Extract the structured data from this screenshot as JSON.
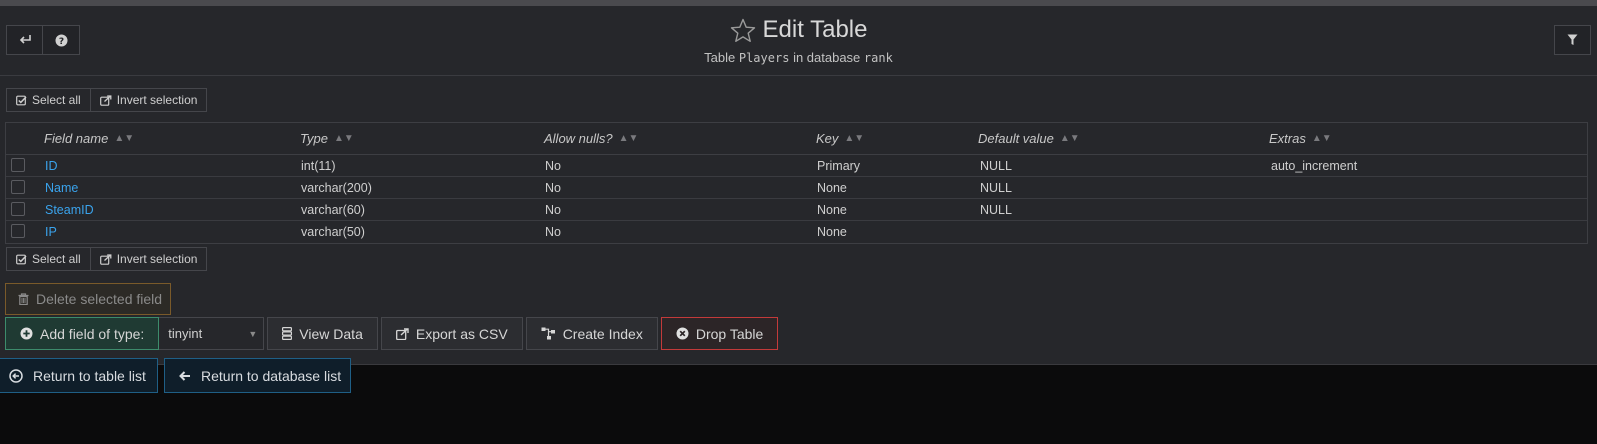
{
  "header": {
    "title": "Edit Table",
    "subtitle_prefix": "Table",
    "table_name": "Players",
    "subtitle_mid": "in database",
    "db_name": "rank",
    "back_icon": "back-arrow-icon",
    "help_icon": "question-icon",
    "filter_icon": "filter-icon",
    "favorite_icon": "star-outline-icon"
  },
  "selection": {
    "select_all": "Select all",
    "invert": "Invert selection"
  },
  "table": {
    "columns": [
      "Field name",
      "Type",
      "Allow nulls?",
      "Key",
      "Default value",
      "Extras"
    ],
    "rows": [
      {
        "name": "ID",
        "type": "int(11)",
        "nulls": "No",
        "key": "Primary",
        "default": "NULL",
        "extras": "auto_increment"
      },
      {
        "name": "Name",
        "type": "varchar(200)",
        "nulls": "No",
        "key": "None",
        "default": "NULL",
        "extras": ""
      },
      {
        "name": "SteamID",
        "type": "varchar(60)",
        "nulls": "No",
        "key": "None",
        "default": "NULL",
        "extras": ""
      },
      {
        "name": "IP",
        "type": "varchar(50)",
        "nulls": "No",
        "key": "None",
        "default": "",
        "extras": ""
      }
    ]
  },
  "actions": {
    "delete_field": "Delete selected field",
    "add_field": "Add field of type:",
    "field_type_value": "tinyint",
    "view_data": "View Data",
    "export_csv": "Export as CSV",
    "create_index": "Create Index",
    "drop_table": "Drop Table"
  },
  "nav": {
    "return_tables": "Return to table list",
    "return_databases": "Return to database list"
  },
  "colors": {
    "link": "#3aa3ec",
    "panel": "#26272b",
    "danger": "#c33a3a",
    "success": "#3d8c6c"
  }
}
